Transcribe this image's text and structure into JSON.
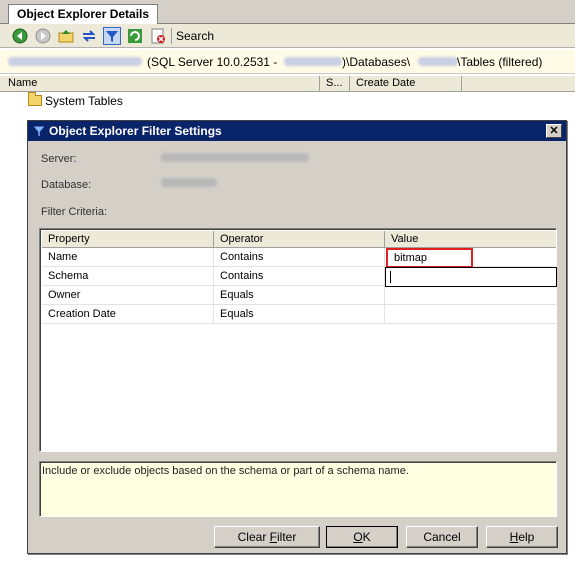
{
  "tab": {
    "title": "Object Explorer Details"
  },
  "toolbar": {
    "icons": [
      "back-icon",
      "forward-icon",
      "up-folder-icon",
      "sync-icon",
      "filter-icon",
      "refresh-icon",
      "stop-icon"
    ],
    "search_label": "Search"
  },
  "path": {
    "server_version": "(SQL Server 10.0.2531 -",
    "databases_segment": ")\\Databases\\",
    "tables_segment": "\\Tables (filtered)"
  },
  "list": {
    "columns": {
      "name": "Name",
      "s": "S...",
      "create_date": "Create Date"
    },
    "rows": [
      {
        "label": "System Tables"
      }
    ]
  },
  "dialog": {
    "title": "Object Explorer Filter Settings",
    "close_label": "✕",
    "server_label": "Server:",
    "database_label": "Database:",
    "filter_criteria_label": "Filter Criteria:",
    "grid": {
      "headers": {
        "property": "Property",
        "operator": "Operator",
        "value": "Value"
      },
      "rows": [
        {
          "property": "Name",
          "operator": "Contains",
          "value": "bitmap"
        },
        {
          "property": "Schema",
          "operator": "Contains",
          "value": ""
        },
        {
          "property": "Owner",
          "operator": "Equals",
          "value": ""
        },
        {
          "property": "Creation Date",
          "operator": "Equals",
          "value": ""
        }
      ]
    },
    "description": "Include or exclude objects based on the schema or part of a schema name.",
    "buttons": {
      "clear_filter": {
        "pre": "Clear ",
        "key": "F",
        "post": "ilter"
      },
      "ok": {
        "pre": "",
        "key": "O",
        "post": "K"
      },
      "cancel": "Cancel",
      "help": {
        "pre": "",
        "key": "H",
        "post": "elp"
      }
    }
  },
  "colors": {
    "title_bar": "#0a246a",
    "highlight_box": "#e02020",
    "description_bg": "#ffffe1"
  }
}
